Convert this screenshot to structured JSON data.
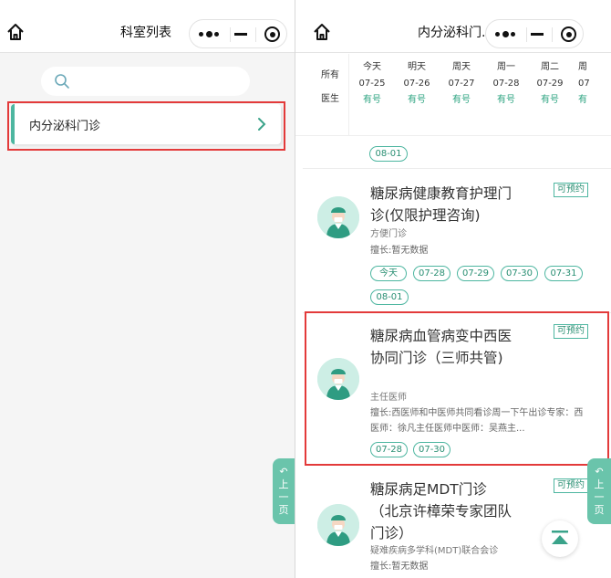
{
  "left": {
    "nav": {
      "title": "科室列表"
    },
    "search": {
      "placeholder": ""
    },
    "departments": [
      {
        "label": "内分泌科门诊"
      }
    ]
  },
  "right": {
    "nav": {
      "title": "内分泌科门..."
    },
    "date_bar": {
      "all_label_1": "所有",
      "all_label_2": "医生",
      "days": [
        {
          "weekday": "今天",
          "date": "07-25",
          "status": "有号"
        },
        {
          "weekday": "明天",
          "date": "07-26",
          "status": "有号"
        },
        {
          "weekday": "周天",
          "date": "07-27",
          "status": "有号"
        },
        {
          "weekday": "周一",
          "date": "07-28",
          "status": "有号"
        },
        {
          "weekday": "周二",
          "date": "07-29",
          "status": "有号"
        },
        {
          "weekday": "周",
          "date": "07",
          "status": "有"
        }
      ]
    },
    "prev_chip": "08-01",
    "doctors": [
      {
        "name": "糖尿病健康教育护理门诊(仅限护理咨询)",
        "title": "方便门诊",
        "skill": "擅长:暂无数据",
        "badge": "可预约",
        "dates": [
          "今天",
          "07-28",
          "07-29",
          "07-30",
          "07-31",
          "08-01"
        ]
      },
      {
        "name": "糖尿病血管病变中西医协同门诊（三师共管)",
        "title": "主任医师",
        "skill": "擅长:西医师和中医师共同看诊周一下午出诊专家：西医师：徐凡主任医师中医师：吴燕主...",
        "badge": "可预约",
        "dates": [
          "07-28",
          "07-30"
        ]
      },
      {
        "name": "糖尿病足MDT门诊（北京许樟荣专家团队门诊）",
        "title": "疑难疾病多学科(MDT)联合会诊",
        "skill": "擅长:暂无数据",
        "badge": "可预约",
        "dates": []
      }
    ],
    "back_tab": {
      "c1": "上",
      "c2": "一",
      "c3": "页"
    }
  },
  "colors": {
    "accent": "#4db6a0",
    "highlight": "#e33a3a"
  }
}
